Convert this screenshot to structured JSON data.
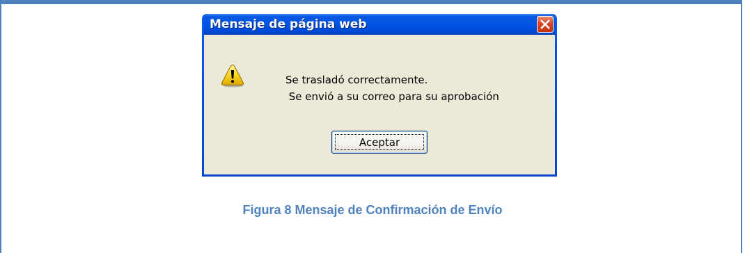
{
  "dialog": {
    "title": "Mensaje de página web",
    "message_line1": "Se trasladó correctamente.",
    "message_line2": " Se envió a su correo para su aprobación",
    "ok_label": "Aceptar",
    "icon": "warning-icon",
    "close_icon": "close-icon"
  },
  "caption": {
    "text": "Figura 8 Mensaje de Confirmación de Envío"
  },
  "colors": {
    "frame_border": "#4f81bd",
    "caption": "#4f81bd",
    "titlebar": "#0054e3",
    "client_bg": "#ece9d8",
    "close_button": "#d9401f"
  }
}
